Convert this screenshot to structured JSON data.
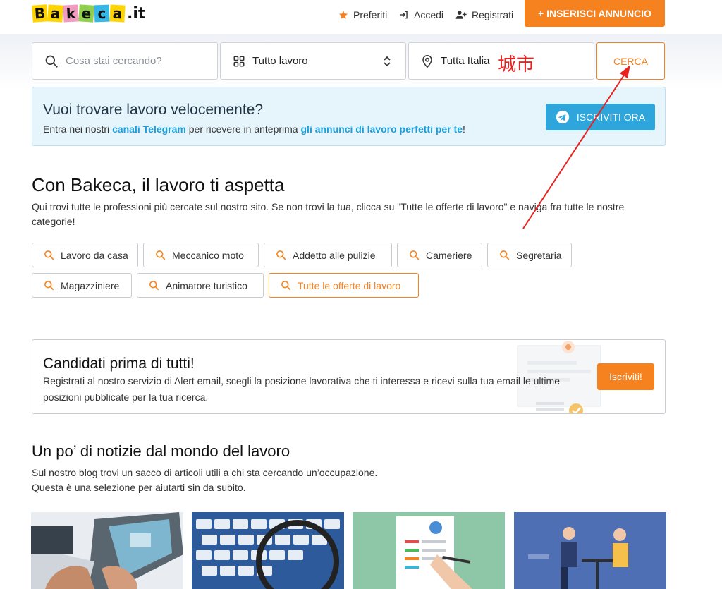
{
  "header": {
    "logo_letters": [
      "B",
      "a",
      "k",
      "e",
      "c",
      "a"
    ],
    "logo_suffix": ".it",
    "nav": {
      "preferiti": "Preferiti",
      "accedi": "Accedi",
      "registrati": "Registrati"
    },
    "insert_button": "+ INSERISCI ANNUNCIO"
  },
  "search": {
    "query_placeholder": "Cosa stai cercando?",
    "category_value": "Tutto lavoro",
    "location_value": "Tutta Italia",
    "annotation": "城市",
    "submit_label": "CERCA"
  },
  "telegram": {
    "title": "Vuoi trovare lavoro velocemente?",
    "text_before": "Entra nei nostri ",
    "link1": "canali Telegram",
    "text_middle": " per ricevere in anteprima ",
    "link2": "gli annunci di lavoro perfetti per te",
    "text_after": "!",
    "button": "ISCRIVITI ORA"
  },
  "categories_section": {
    "title": "Con Bakeca, il lavoro ti aspetta",
    "description": "Qui trovi tutte le professioni più cercate sul nostro sito. Se non trovi la tua, clicca su \"Tutte le offerte di lavoro\" e naviga fra tutte le nostre categorie!",
    "chips": [
      "Lavoro da casa",
      "Meccanico moto",
      "Addetto alle pulizie",
      "Cameriere",
      "Segretaria",
      "Magazziniere",
      "Animatore turistico",
      "Tutte le offerte di lavoro"
    ]
  },
  "alert_card": {
    "title": "Candidati prima di tutti!",
    "text": "Registrati al nostro servizio di Alert email, scegli la posizione lavorativa che ti interessa e ricevi sulla tua email le ultime posizioni pubblicate per la tua ricerca.",
    "button": "Iscriviti!"
  },
  "news_section": {
    "title": "Un po’ di notizie dal mondo del lavoro",
    "line1": "Sul nostro blog trovi un sacco di articoli utili a chi sta cercando un’occupazione.",
    "line2": "Questa è una selezione per aiutarti sin da subito."
  },
  "colors": {
    "accent": "#f5821f",
    "telegram_blue": "#2ea6dc",
    "annotation_red": "#e8231f"
  },
  "icons": [
    "star-icon",
    "login-icon",
    "user-plus-icon",
    "search-icon",
    "grid-icon",
    "chevron-updown-icon",
    "location-pin-icon",
    "telegram-icon"
  ]
}
